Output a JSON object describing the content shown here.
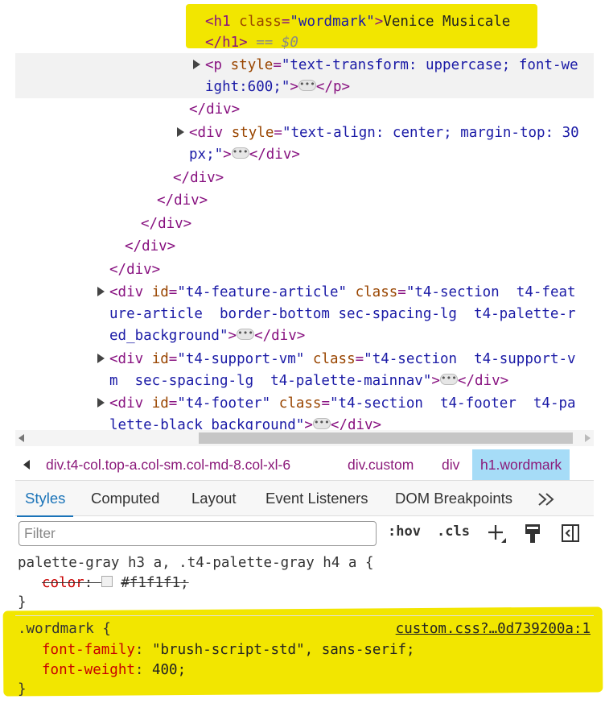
{
  "dom": {
    "h1_tag_open": "<h1",
    "h1_attr_name": "class",
    "h1_attr_value": "\"wordmark\"",
    "h1_text": "Venice Musicale",
    "h1_close": "</h1>",
    "h1_eq": "== $0",
    "p_tag": "<p",
    "p_attr_name": "style",
    "p_attr_value_1": "\"text-transform: uppercase; font-we",
    "p_attr_value_2": "ight:600;\"",
    "p_close": "</p>",
    "div_close": "</div>",
    "div_style_tag": "<div",
    "div_style_attr": "style",
    "div_style_val_1": "\"text-align: center; margin-top: 30",
    "div_style_val_2": "px;\"",
    "feature_tag": "<div",
    "feature_id_attr": "id",
    "feature_id_val": "\"t4-feature-article\"",
    "feature_class_attr": "class",
    "feature_class_val_1": "\"t4-section  t4-feat",
    "feature_class_val_2": "ure-article  border-bottom sec-spacing-lg  t4-palette-r",
    "feature_class_val_3": "ed_background\"",
    "support_tag": "<div",
    "support_id_attr": "id",
    "support_id_val": "\"t4-support-vm\"",
    "support_class_attr": "class",
    "support_class_val_1": "\"t4-section  t4-support-v",
    "support_class_val_2": "m  sec-spacing-lg  t4-palette-mainnav\"",
    "footer_tag": "<div",
    "footer_id_attr": "id",
    "footer_id_val": "\"t4-footer\"",
    "footer_class_attr": "class",
    "footer_class_val_1": "\"t4-section  t4-footer  t4-pa",
    "footer_class_val_2": "lette-black_background\""
  },
  "breadcrumbs": {
    "items": [
      "div.t4-col.top-a.col-sm.col-md-8.col-xl-6",
      "div.custom",
      "div",
      "h1.wordmark"
    ]
  },
  "tabs": [
    "Styles",
    "Computed",
    "Layout",
    "Event Listeners",
    "DOM Breakpoints"
  ],
  "toolbar": {
    "filter_placeholder": "Filter",
    "hov_label": ":hov",
    "cls_label": ".cls"
  },
  "styles": {
    "prev_selector": "palette-gray h3 a, .t4-palette-gray h4 a {",
    "prev_prop": "color",
    "prev_value": "#f1f1f1",
    "close_brace": "}",
    "rule_selector": ".wordmark {",
    "rule_source": "custom.css?…0d739200a:1",
    "decl1_prop": "font-family",
    "decl1_value": "\"brush-script-std\", sans-serif;",
    "decl2_prop": "font-weight",
    "decl2_value": "400;"
  },
  "colors": {
    "highlight": "#f2e600",
    "tag": "#881280",
    "attr": "#994500",
    "value": "#1a1aa6",
    "active_tab": "#1a73b8",
    "selected_crumb": "#a6dcf7"
  }
}
